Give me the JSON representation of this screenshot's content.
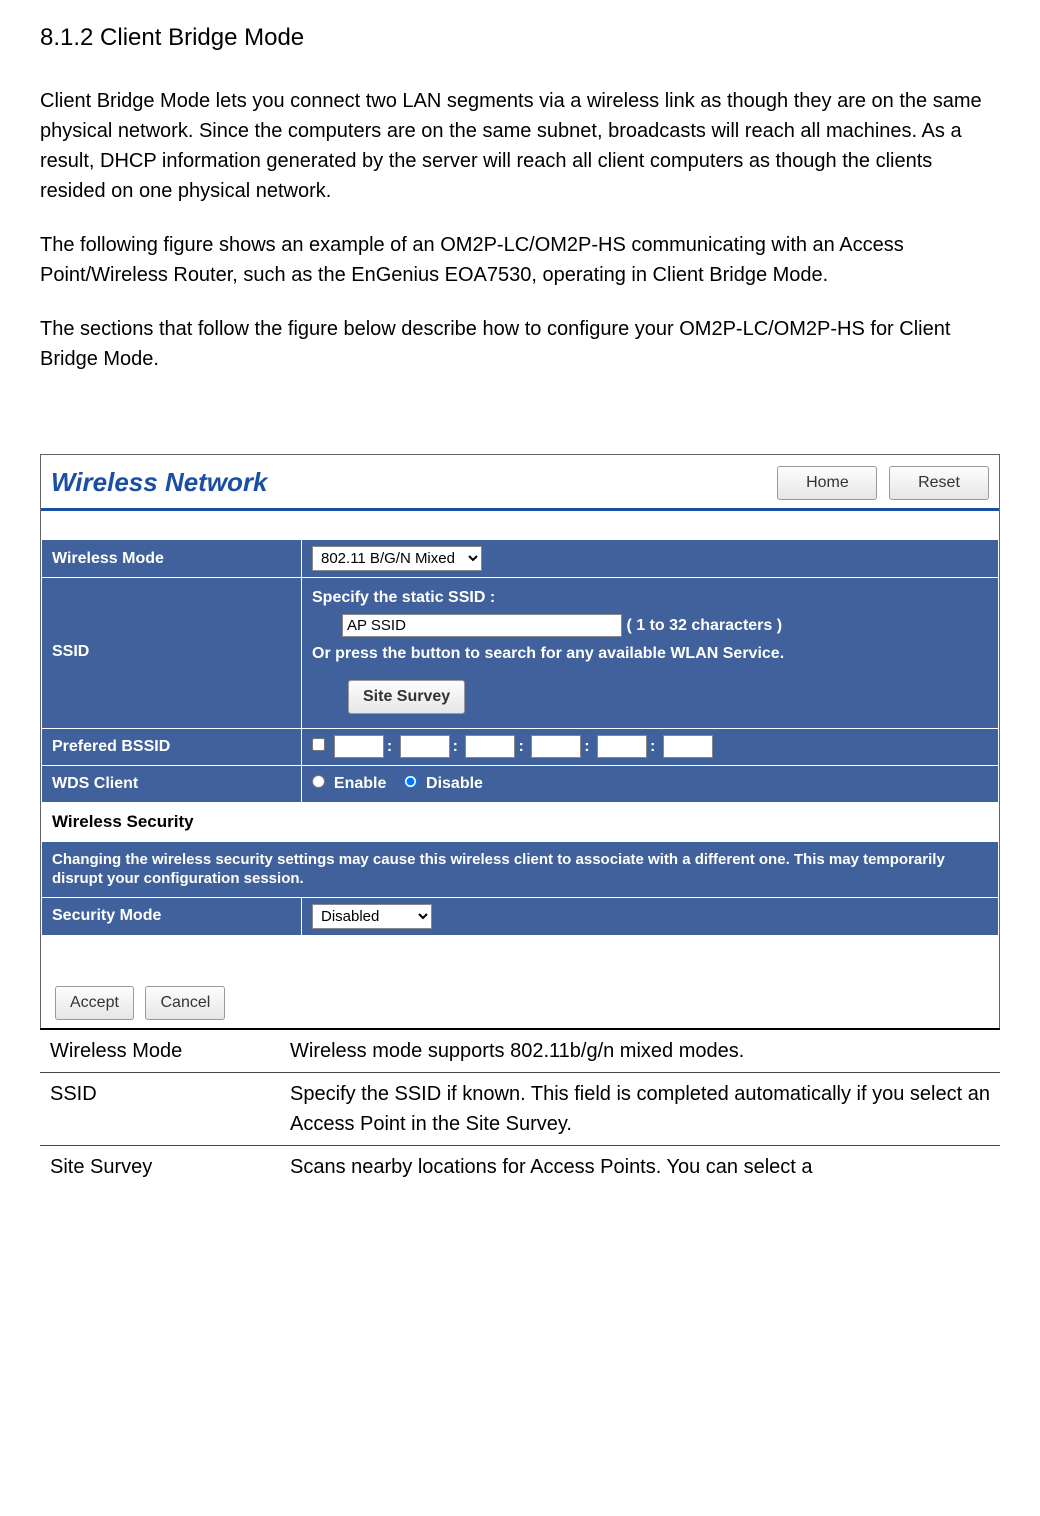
{
  "doc": {
    "heading": "8.1.2 Client Bridge Mode",
    "p1": "Client Bridge Mode lets you connect two LAN segments via a wireless link as though they are on the same physical network. Since the computers are on the same subnet, broadcasts will reach all machines. As a result, DHCP information generated by the server will reach all client computers as though the clients resided on one physical network.",
    "p2a": "The following figure shows an example of an OM2P-LC/OM2P-HS communicating with an Access",
    "p2b": "Point/Wireless Router, such as the EnGenius EOA7530, operating in Client Bridge Mode.",
    "p3a": "The sections that follow the figure below describe how to configure your OM2P-LC/OM2P-HS for Client",
    "p3b": "Bridge Mode."
  },
  "panel": {
    "title": "Wireless Network",
    "home": "Home",
    "reset": "Reset"
  },
  "form": {
    "wireless_mode_label": "Wireless Mode",
    "wireless_mode_value": "802.11 B/G/N Mixed",
    "ssid_label": "SSID",
    "ssid_line1": "Specify the static SSID  :",
    "ssid_value": "AP SSID",
    "ssid_hint": "( 1 to 32 characters )",
    "ssid_line2": "Or press the button to search for any available WLAN Service.",
    "site_survey_btn": "Site Survey",
    "bssid_label": "Prefered BSSID",
    "wds_label": "WDS Client",
    "wds_enable": "Enable",
    "wds_disable": "Disable",
    "sec_heading": "Wireless Security",
    "warning": "Changing the wireless security settings may cause this wireless client to associate with a different one. This may temporarily disrupt your configuration session.",
    "sec_mode_label": "Security Mode",
    "sec_mode_value": "Disabled",
    "accept": "Accept",
    "cancel": "Cancel"
  },
  "desc": {
    "r1_label": "Wireless Mode",
    "r1_text": "Wireless mode supports 802.11b/g/n mixed modes.",
    "r2_label": "SSID",
    "r2_text": "Specify the SSID if known. This field is completed automatically if you select an Access Point in the Site Survey.",
    "r3_label": "Site Survey",
    "r3_text": "Scans nearby locations for Access Points. You can select a"
  }
}
